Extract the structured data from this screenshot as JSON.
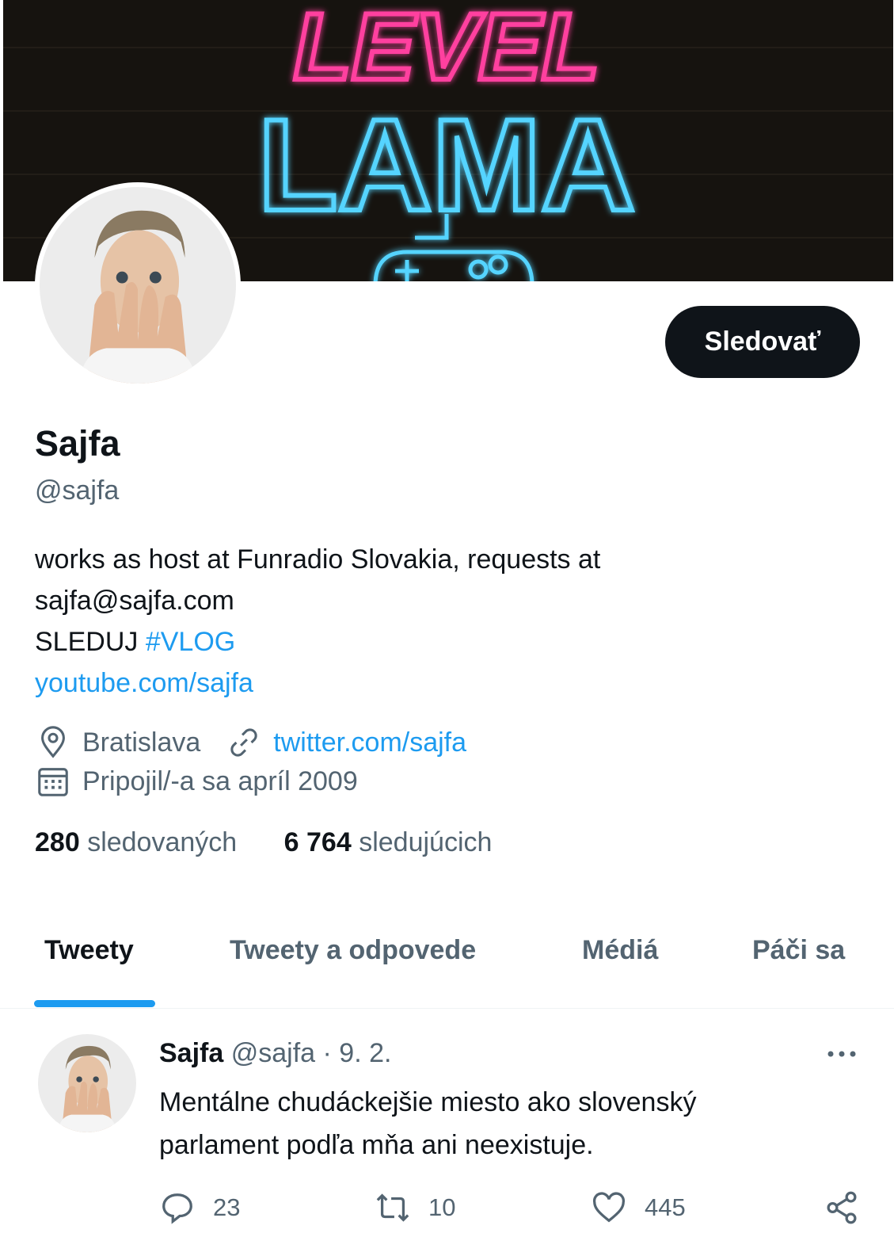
{
  "banner": {
    "top_text": "LEVEL",
    "main_text": "LAMA",
    "colors": {
      "pink": "#ff3f9f",
      "blue": "#55d4ff",
      "background": "#16130f"
    }
  },
  "profile": {
    "follow_label": "Sledovať",
    "name": "Sajfa",
    "handle": "@sajfa",
    "bio": {
      "line1": "works as host at Funradio Slovakia, requests at",
      "line2": "sajfa@sajfa.com",
      "line3_text": "SLEDUJ",
      "line3_hashtag": "#VLOG",
      "line4_link": "youtube.com/sajfa"
    },
    "location": "Bratislava",
    "website": "twitter.com/sajfa",
    "joined": "Pripojil/-a sa apríl 2009",
    "following_count": "280",
    "following_label": "sledovaných",
    "followers_count": "6 764",
    "followers_label": "sledujúcich"
  },
  "tabs": [
    {
      "label": "Tweety",
      "active": true
    },
    {
      "label": "Tweety a odpovede",
      "active": false
    },
    {
      "label": "Médiá",
      "active": false
    },
    {
      "label": "Páči sa",
      "active": false
    }
  ],
  "tweet": {
    "name": "Sajfa",
    "handle": "@sajfa",
    "separator": "·",
    "date": "9. 2.",
    "text_line1": "Mentálne chudáckejšie miesto ako slovenský",
    "text_line2": "parlament podľa mňa ani neexistuje.",
    "replies": "23",
    "retweets": "10",
    "likes": "445"
  },
  "icons": {
    "location": "location-pin-icon",
    "website": "link-icon",
    "joined": "calendar-icon",
    "more": "more-dots-icon",
    "reply": "reply-icon",
    "retweet": "retweet-icon",
    "like": "heart-icon",
    "share": "share-icon"
  },
  "accent": "#1d9bf0"
}
